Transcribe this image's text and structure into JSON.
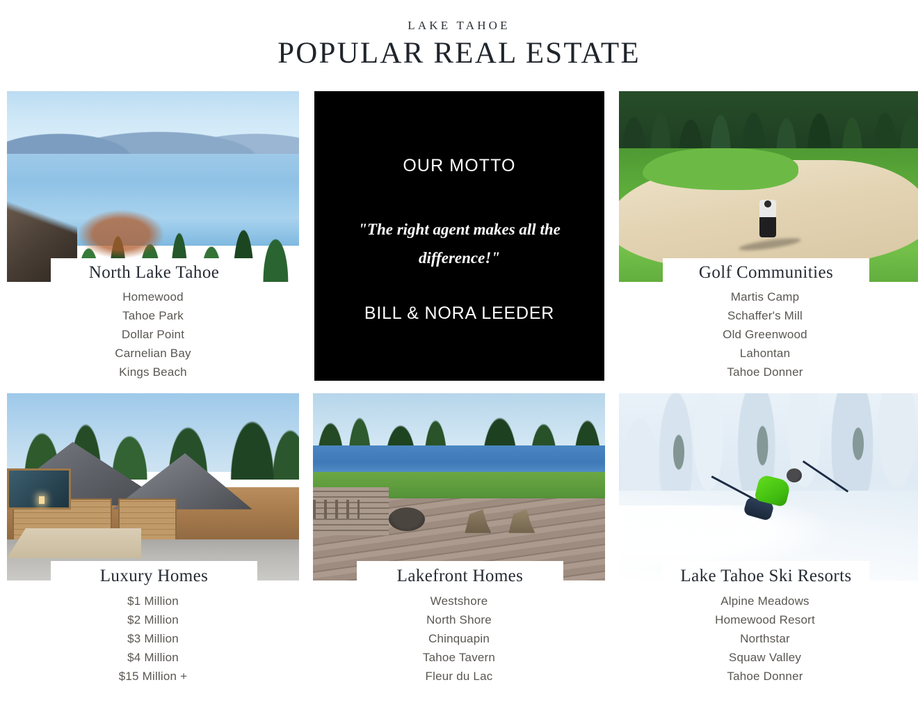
{
  "header": {
    "eyebrow": "LAKE TAHOE",
    "title": "POPULAR REAL ESTATE"
  },
  "motto": {
    "label": "OUR MOTTO",
    "quote": "\"The right agent makes all the difference!\"",
    "author": "BILL & NORA LEEDER",
    "background_color": "#000000",
    "text_color": "#ffffff"
  },
  "colors": {
    "page_background": "#ffffff",
    "title_text": "#262b33",
    "list_text": "#5a5752",
    "band_background": "#ffffff"
  },
  "cards": [
    {
      "id": "north-lake-tahoe",
      "title": "North Lake Tahoe",
      "photo_alt": "lake-view-photo",
      "items": [
        "Homewood",
        "Tahoe Park",
        "Dollar Point",
        "Carnelian Bay",
        "Kings Beach"
      ]
    },
    {
      "id": "golf-communities",
      "title": "Golf Communities",
      "photo_alt": "golf-course-photo",
      "items": [
        "Martis Camp",
        "Schaffer's Mill",
        "Old Greenwood",
        "Lahontan",
        "Tahoe Donner"
      ]
    },
    {
      "id": "luxury-homes",
      "title": "Luxury Homes",
      "photo_alt": "luxury-home-photo",
      "items": [
        "$1 Million",
        "$2 Million",
        "$3 Million",
        "$4 Million",
        "$15 Million +"
      ]
    },
    {
      "id": "lakefront-homes",
      "title": "Lakefront Homes",
      "photo_alt": "lakefront-deck-photo",
      "items": [
        "Westshore",
        "North Shore",
        "Chinquapin",
        "Tahoe Tavern",
        "Fleur du Lac"
      ]
    },
    {
      "id": "lake-tahoe-ski-resorts",
      "title": "Lake Tahoe Ski Resorts",
      "photo_alt": "skier-photo",
      "items": [
        "Alpine Meadows",
        "Homewood Resort",
        "Northstar",
        "Squaw Valley",
        "Tahoe Donner"
      ]
    }
  ]
}
